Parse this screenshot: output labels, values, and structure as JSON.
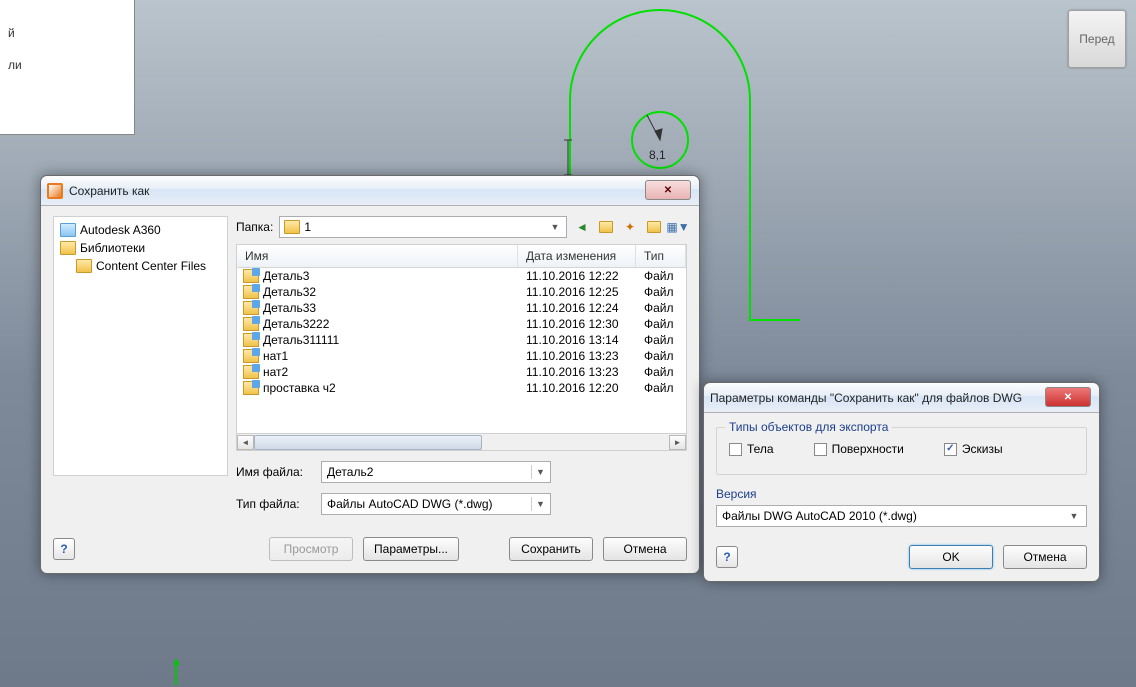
{
  "panel": {
    "line1": "й",
    "line2": "ли"
  },
  "cube_label": "Перед",
  "sketch_dim": "8,1",
  "save_dialog": {
    "title": "Сохранить как",
    "tree": {
      "a360": "Autodesk A360",
      "libs": "Библиотеки",
      "cc": "Content Center Files"
    },
    "folder_label": "Папка:",
    "folder_value": "1",
    "columns": {
      "name": "Имя",
      "date": "Дата изменения",
      "type": "Тип"
    },
    "files": [
      {
        "name": "Деталь3",
        "date": "11.10.2016 12:22",
        "type": "Файл"
      },
      {
        "name": "Деталь32",
        "date": "11.10.2016 12:25",
        "type": "Файл"
      },
      {
        "name": "Деталь33",
        "date": "11.10.2016 12:24",
        "type": "Файл"
      },
      {
        "name": "Деталь3222",
        "date": "11.10.2016 12:30",
        "type": "Файл"
      },
      {
        "name": "Деталь311111",
        "date": "11.10.2016 13:14",
        "type": "Файл"
      },
      {
        "name": "нат1",
        "date": "11.10.2016 13:23",
        "type": "Файл"
      },
      {
        "name": "нат2",
        "date": "11.10.2016 13:23",
        "type": "Файл"
      },
      {
        "name": "проставка ч2",
        "date": "11.10.2016 12:20",
        "type": "Файл"
      }
    ],
    "filename_label": "Имя файла:",
    "filename_value": "Деталь2",
    "filetype_label": "Тип файла:",
    "filetype_value": "Файлы AutoCAD DWG (*.dwg)",
    "preview_btn": "Просмотр",
    "params_btn": "Параметры...",
    "save_btn": "Сохранить",
    "cancel_btn": "Отмена"
  },
  "params_dialog": {
    "title": "Параметры команды \"Сохранить как\" для файлов DWG",
    "group_title": "Типы объектов для экспорта",
    "cb_solids": "Тела",
    "cb_surfaces": "Поверхности",
    "cb_sketches": "Эскизы",
    "version_label": "Версия",
    "version_value": "Файлы DWG AutoCAD 2010 (*.dwg)",
    "ok_btn": "OK",
    "cancel_btn": "Отмена"
  }
}
